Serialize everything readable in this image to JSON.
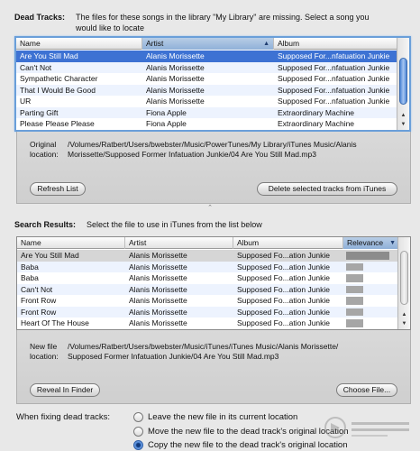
{
  "dead_tracks": {
    "heading": "Dead Tracks:",
    "description": "The files for these songs in the library \"My Library\" are missing.  Select a song you would like to locate",
    "columns": [
      "Name",
      "Artist",
      "Album"
    ],
    "rows": [
      {
        "name": "Are You Still Mad",
        "artist": "Alanis Morissette",
        "album": "Supposed For...nfatuation Junkie",
        "selected": true
      },
      {
        "name": "Can't Not",
        "artist": "Alanis Morissette",
        "album": "Supposed For...nfatuation Junkie"
      },
      {
        "name": "Sympathetic Character",
        "artist": "Alanis Morissette",
        "album": "Supposed For...nfatuation Junkie"
      },
      {
        "name": "That I Would Be Good",
        "artist": "Alanis Morissette",
        "album": "Supposed For...nfatuation Junkie"
      },
      {
        "name": "UR",
        "artist": "Alanis Morissette",
        "album": "Supposed For...nfatuation Junkie"
      },
      {
        "name": "Parting Gift",
        "artist": "Fiona Apple",
        "album": "Extraordinary Machine"
      },
      {
        "name": "Please Please Please",
        "artist": "Fiona Apple",
        "album": "Extraordinary Machine"
      }
    ],
    "original_location_label_1": "Original",
    "original_location_label_2": "location:",
    "original_location_line_1": "/Volumes/Ratbert/Users/bwebster/Music/PowerTunes/My Library/iTunes Music/Alanis",
    "original_location_line_2": "Morissette/Supposed Former Infatuation Junkie/04 Are You Still Mad.mp3",
    "refresh_button": "Refresh List",
    "delete_button": "Delete selected tracks from iTunes"
  },
  "search_results": {
    "heading": "Search Results:",
    "description": "Select the file to use in iTunes from the list below",
    "columns": [
      "Name",
      "Artist",
      "Album",
      "Relevance"
    ],
    "rows": [
      {
        "name": "Are You Still Mad",
        "artist": "Alanis Morissette",
        "album": "Supposed Fo...ation Junkie",
        "relevance": 1.0,
        "selected": true
      },
      {
        "name": "Baba",
        "artist": "Alanis Morissette",
        "album": "Supposed Fo...ation Junkie",
        "relevance": 0.4
      },
      {
        "name": "Baba",
        "artist": "Alanis Morissette",
        "album": "Supposed Fo...ation Junkie",
        "relevance": 0.4
      },
      {
        "name": "Can't Not",
        "artist": "Alanis Morissette",
        "album": "Supposed Fo...ation Junkie",
        "relevance": 0.4
      },
      {
        "name": "Front Row",
        "artist": "Alanis Morissette",
        "album": "Supposed Fo...ation Junkie",
        "relevance": 0.4
      },
      {
        "name": "Front Row",
        "artist": "Alanis Morissette",
        "album": "Supposed Fo...ation Junkie",
        "relevance": 0.4
      },
      {
        "name": "Heart Of The House",
        "artist": "Alanis Morissette",
        "album": "Supposed Fo...ation Junkie",
        "relevance": 0.4
      }
    ],
    "new_file_label_1": "New file",
    "new_file_label_2": "location:",
    "new_file_line_1": "/Volumes/Ratbert/Users/bwebster/Music/iTunes/iTunes Music/Alanis Morissette/",
    "new_file_line_2": "Supposed Former Infatuation Junkie/04 Are You Still Mad.mp3",
    "reveal_button": "Reveal In Finder",
    "choose_button": "Choose File..."
  },
  "fixing": {
    "label": "When fixing dead tracks:",
    "options": [
      {
        "label": "Leave the new file in its current location",
        "selected": false
      },
      {
        "label": "Move the new file to the dead track's original location",
        "selected": false
      },
      {
        "label": "Copy the new file to the dead track's original location",
        "selected": true
      }
    ]
  },
  "colors": {
    "selection": "#3d72d3",
    "focus_ring": "#6a9fd9",
    "relevance_bar": "#a6a6a6"
  }
}
